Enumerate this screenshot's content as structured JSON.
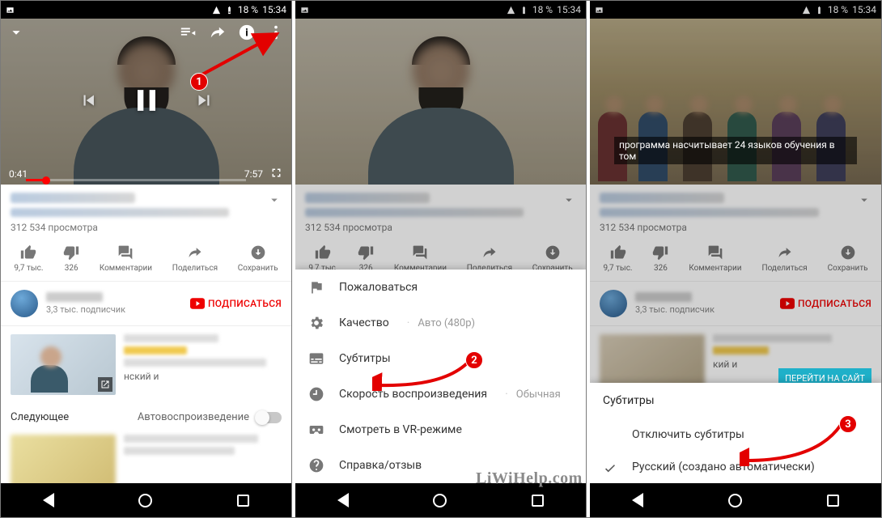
{
  "status": {
    "battery": "18 %",
    "time": "15:34"
  },
  "player": {
    "elapsed": "0:41",
    "duration": "7:57"
  },
  "video": {
    "views": "312 534 просмотра"
  },
  "actions": {
    "likes": "9,7 тыс.",
    "dislikes": "326",
    "comments": "Комментарии",
    "share": "Поделиться",
    "save": "Сохранить"
  },
  "channel": {
    "subs": "3,3 тыс. подписчик",
    "subscribe": "ПОДПИСАТЬСЯ"
  },
  "next": {
    "title": "Следующее",
    "autoplay": "Автовоспроизведение"
  },
  "sheet1": {
    "report": "Пожаловаться",
    "quality": "Качество",
    "quality_val": "Авто (480p)",
    "captions": "Субтитры",
    "speed": "Скорость воспроизведения",
    "speed_val": "Обычная",
    "vr": "Смотреть в VR-режиме",
    "help": "Справка/отзыв"
  },
  "sheet2": {
    "header": "Субтитры",
    "off": "Отключить субтитры",
    "lang": "Русский (создано автоматически)"
  },
  "caption_text": "программа насчитывает 24 языков обучения в том",
  "go_site": "ПЕРЕЙТИ НА САЙТ",
  "rec_snippet": "нский и",
  "rec_snippet2": "кий и",
  "badges": {
    "one": "1",
    "two": "2",
    "three": "3"
  },
  "watermark": "LiWiHelp.com"
}
